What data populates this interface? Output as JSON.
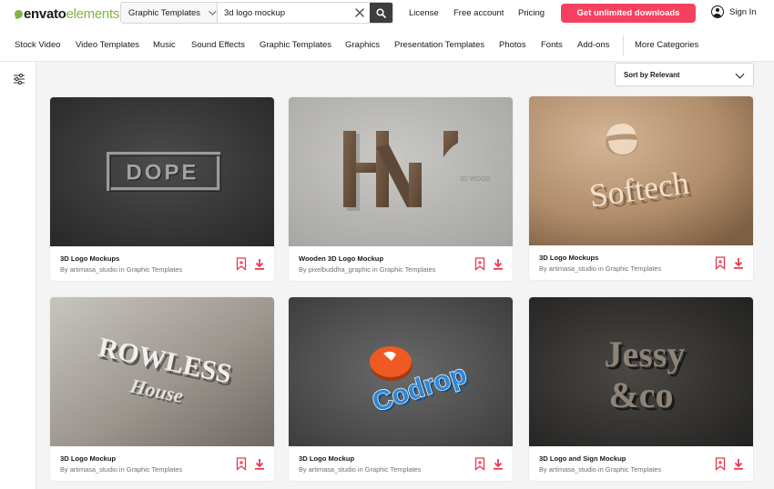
{
  "brand": {
    "part1": "envato",
    "part2": "elements",
    "accent": "#82b541"
  },
  "search": {
    "category": "Graphic Templates",
    "query": "3d logo mockup"
  },
  "header_links": {
    "license": "License",
    "free_account": "Free account",
    "pricing": "Pricing"
  },
  "cta": {
    "label": "Get unlimited downloads",
    "color": "#f5415f"
  },
  "signin": {
    "label": "Sign In"
  },
  "categories": [
    "Stock Video",
    "Video Templates",
    "Music",
    "Sound Effects",
    "Graphic Templates",
    "Graphics",
    "Presentation Templates",
    "Photos",
    "Fonts",
    "Add-ons"
  ],
  "more_categories": "More Categories",
  "sort": {
    "label": "Sort by Relevant"
  },
  "results": [
    {
      "title": "3D Logo Mockups",
      "by": "By",
      "author": "artimasa_studio",
      "in": "in",
      "category": "Graphic Templates",
      "art_text": "DOPE"
    },
    {
      "title": "Wooden 3D Logo Mockup",
      "by": "By",
      "author": "pixelbuddha_graphic",
      "in": "in",
      "category": "Graphic Templates",
      "art_text": "3D WOOD"
    },
    {
      "title": "3D Logo Mockups",
      "by": "By",
      "author": "artimasa_studio",
      "in": "in",
      "category": "Graphic Templates",
      "art_text": "Softech"
    },
    {
      "title": "3D Logo Mockup",
      "by": "By",
      "author": "artimasa_studio",
      "in": "in",
      "category": "Graphic Templates",
      "art_text": "ROWLESS",
      "art_text2": "House"
    },
    {
      "title": "3D Logo Mockup",
      "by": "By",
      "author": "artimasa_studio",
      "in": "in",
      "category": "Graphic Templates",
      "art_text": "Codrop"
    },
    {
      "title": "3D Logo and Sign Mockup",
      "by": "By",
      "author": "artimasa_studio",
      "in": "in",
      "category": "Graphic Templates",
      "art_text": "Jessy",
      "art_text2": "&co"
    }
  ],
  "icon_colors": {
    "action": "#e8384f"
  }
}
